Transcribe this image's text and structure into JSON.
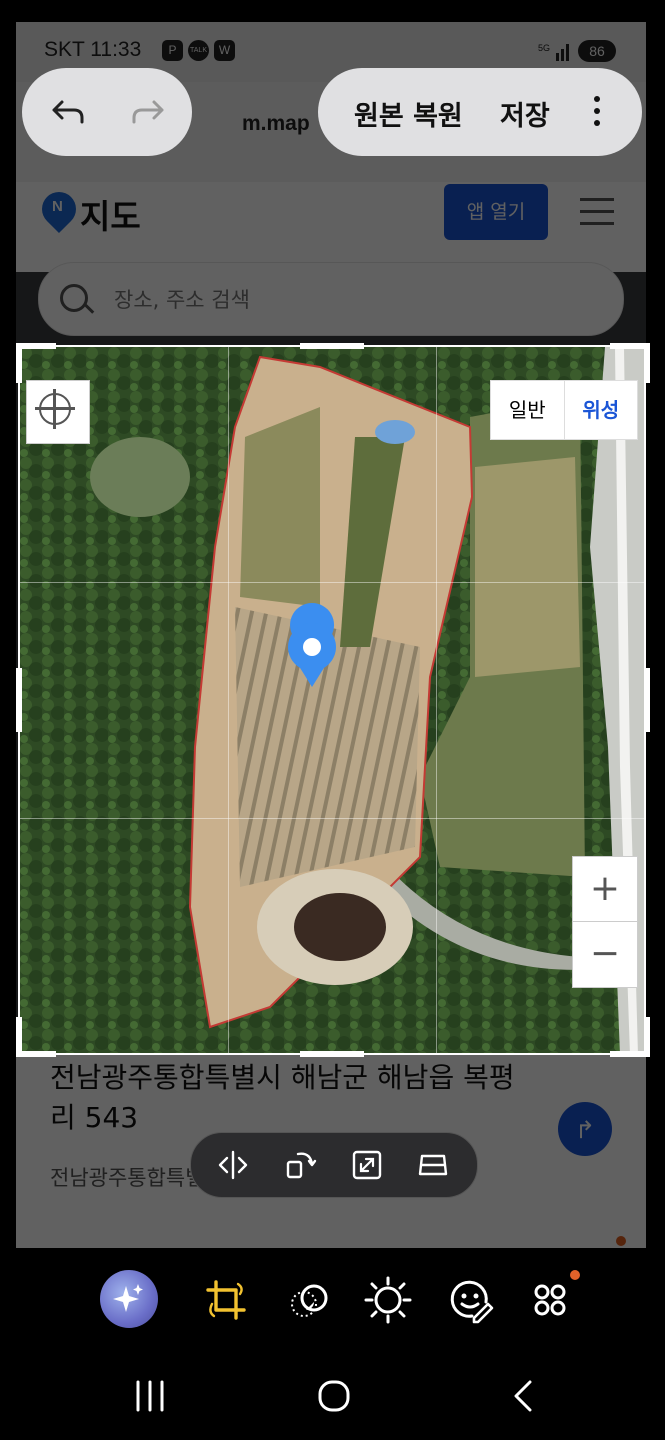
{
  "status_bar": {
    "time": "SKT 11:33",
    "icons": [
      "P",
      "TALK",
      "W"
    ],
    "battery": "86"
  },
  "browser": {
    "url": "m.map"
  },
  "photo_editor_header": {
    "restore_label": "원본 복원",
    "save_label": "저장",
    "undo_icon": "undo-icon",
    "redo_icon": "redo-icon",
    "more_icon": "more-vertical-icon"
  },
  "site_header": {
    "logo_letter": "N",
    "title": "지도",
    "open_app_label": "앱 열기"
  },
  "search": {
    "placeholder": "장소, 주소 검색"
  },
  "map": {
    "type_normal": "일반",
    "type_satellite": "위성",
    "zoom_in": "+",
    "zoom_out": "−"
  },
  "place": {
    "title": "전남광주통합특별시 해남군 해남읍 복평리 543",
    "subtitle": "전남광주통합특별시 해남군 해남읍..."
  },
  "edit_tools": [
    "flip-horizontal-icon",
    "rotate-icon",
    "expand-icon",
    "perspective-icon"
  ],
  "bottom_tools": [
    "ai-sparkle-icon",
    "crop-rotate-icon",
    "filter-icon",
    "brightness-icon",
    "sticker-icon",
    "more-tools-icon"
  ],
  "colors": {
    "accent_blue": "#1a55d6",
    "crop_tool_yellow": "#f2c230",
    "notification_dot": "#e0622a"
  }
}
